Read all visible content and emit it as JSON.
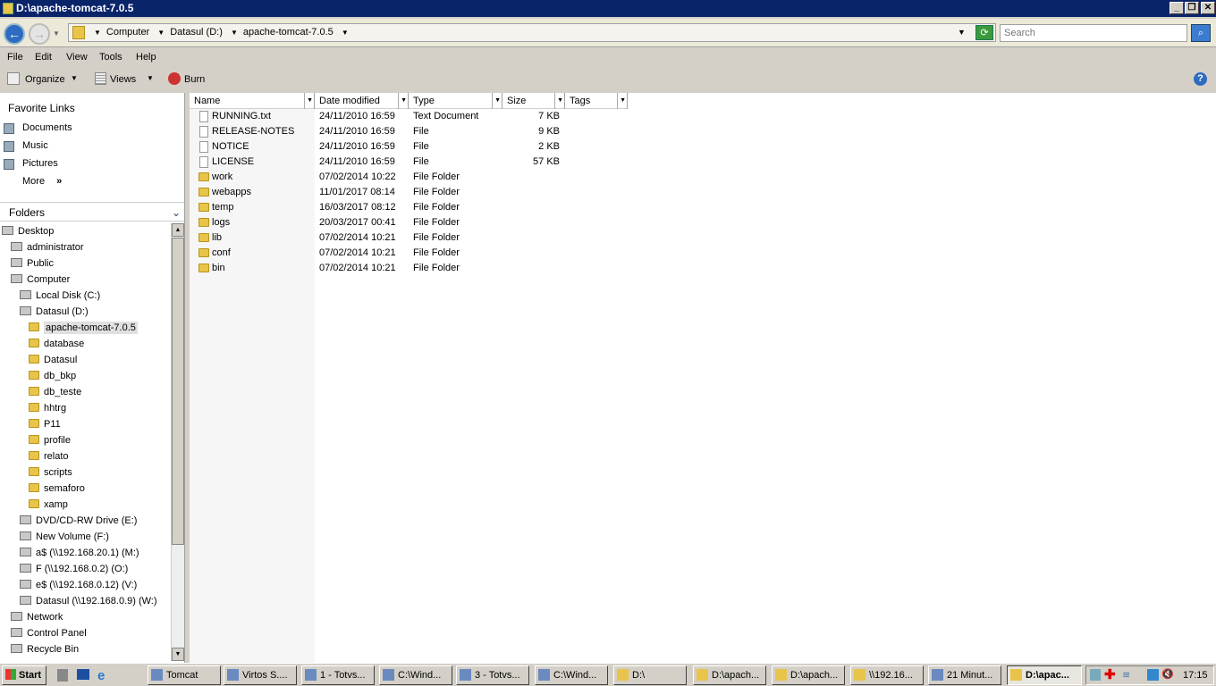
{
  "window": {
    "title": "D:\\apache-tomcat-7.0.5"
  },
  "address": {
    "crumbs": [
      "Computer",
      "Datasul (D:)",
      "apache-tomcat-7.0.5"
    ],
    "search_placeholder": "Search"
  },
  "menu": [
    "File",
    "Edit",
    "View",
    "Tools",
    "Help"
  ],
  "toolbar": {
    "organize": "Organize",
    "views": "Views",
    "burn": "Burn"
  },
  "favorites": {
    "title": "Favorite Links",
    "items": [
      "Documents",
      "Music",
      "Pictures",
      "More"
    ]
  },
  "folders": {
    "title": "Folders",
    "items": [
      {
        "label": "Desktop",
        "level": 0
      },
      {
        "label": "administrator",
        "level": 1
      },
      {
        "label": "Public",
        "level": 1
      },
      {
        "label": "Computer",
        "level": 1
      },
      {
        "label": "Local Disk (C:)",
        "level": 2
      },
      {
        "label": "Datasul (D:)",
        "level": 2
      },
      {
        "label": "apache-tomcat-7.0.5",
        "level": 3,
        "selected": true
      },
      {
        "label": "database",
        "level": 3
      },
      {
        "label": "Datasul",
        "level": 3
      },
      {
        "label": "db_bkp",
        "level": 3
      },
      {
        "label": "db_teste",
        "level": 3
      },
      {
        "label": "hhtrg",
        "level": 3
      },
      {
        "label": "P11",
        "level": 3
      },
      {
        "label": "profile",
        "level": 3
      },
      {
        "label": "relato",
        "level": 3
      },
      {
        "label": "scripts",
        "level": 3
      },
      {
        "label": "semaforo",
        "level": 3
      },
      {
        "label": "xamp",
        "level": 3
      },
      {
        "label": "DVD/CD-RW Drive (E:)",
        "level": 2
      },
      {
        "label": "New Volume (F:)",
        "level": 2
      },
      {
        "label": "a$ (\\\\192.168.20.1) (M:)",
        "level": 2
      },
      {
        "label": "F (\\\\192.168.0.2) (O:)",
        "level": 2
      },
      {
        "label": "e$ (\\\\192.168.0.12) (V:)",
        "level": 2
      },
      {
        "label": "Datasul (\\\\192.168.0.9) (W:)",
        "level": 2
      },
      {
        "label": "Network",
        "level": 1
      },
      {
        "label": "Control Panel",
        "level": 1
      },
      {
        "label": "Recycle Bin",
        "level": 1
      }
    ]
  },
  "columns": [
    "Name",
    "Date modified",
    "Type",
    "Size",
    "Tags"
  ],
  "files": [
    {
      "name": "RUNNING.txt",
      "date": "24/11/2010 16:59",
      "type": "Text Document",
      "size": "7 KB",
      "folder": false
    },
    {
      "name": "RELEASE-NOTES",
      "date": "24/11/2010 16:59",
      "type": "File",
      "size": "9 KB",
      "folder": false
    },
    {
      "name": "NOTICE",
      "date": "24/11/2010 16:59",
      "type": "File",
      "size": "2 KB",
      "folder": false
    },
    {
      "name": "LICENSE",
      "date": "24/11/2010 16:59",
      "type": "File",
      "size": "57 KB",
      "folder": false
    },
    {
      "name": "work",
      "date": "07/02/2014 10:22",
      "type": "File Folder",
      "size": "",
      "folder": true
    },
    {
      "name": "webapps",
      "date": "11/01/2017 08:14",
      "type": "File Folder",
      "size": "",
      "folder": true
    },
    {
      "name": "temp",
      "date": "16/03/2017 08:12",
      "type": "File Folder",
      "size": "",
      "folder": true
    },
    {
      "name": "logs",
      "date": "20/03/2017 00:41",
      "type": "File Folder",
      "size": "",
      "folder": true
    },
    {
      "name": "lib",
      "date": "07/02/2014 10:21",
      "type": "File Folder",
      "size": "",
      "folder": true
    },
    {
      "name": "conf",
      "date": "07/02/2014 10:21",
      "type": "File Folder",
      "size": "",
      "folder": true
    },
    {
      "name": "bin",
      "date": "07/02/2014 10:21",
      "type": "File Folder",
      "size": "",
      "folder": true
    }
  ],
  "taskbar": {
    "start": "Start",
    "clock": "17:15",
    "buttons": [
      "Tomcat",
      "Virtos S....",
      "1 - Totvs...",
      "C:\\Wind...",
      "3 - Totvs...",
      "C:\\Wind...",
      "D:\\",
      "D:\\apach...",
      "D:\\apach...",
      "\\\\192.16...",
      "21 Minut...",
      "D:\\apac..."
    ]
  }
}
